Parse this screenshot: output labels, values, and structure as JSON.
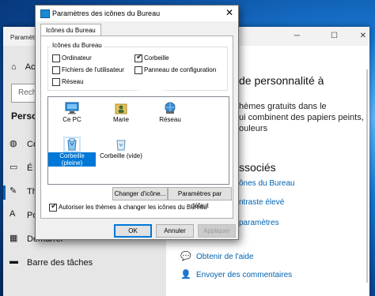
{
  "settings": {
    "window_title": "Paramètres",
    "home_label": "Ac",
    "search_placeholder": "Rech",
    "section_title": "Person",
    "nav": [
      {
        "label": "Co"
      },
      {
        "label": "É"
      },
      {
        "label": "Th"
      },
      {
        "label": "Po"
      },
      {
        "label": "Démarrer"
      },
      {
        "label": "Barre des tâches"
      }
    ],
    "right": {
      "heading1": "de personnalité à",
      "para": [
        "hèmes gratuits dans le",
        "ui combinent des papiers peints,",
        "ouleurs"
      ],
      "heading2": "ssociés",
      "links": [
        "ônes du Bureau",
        "ntraste élevé",
        "paramètres"
      ],
      "help_link": "Obtenir de l'aide",
      "feedback_link": "Envoyer des commentaires"
    }
  },
  "dialog": {
    "title": "Paramètres des icônes du Bureau",
    "tab": "Icônes du Bureau",
    "group_label": "Icônes du Bureau",
    "checkboxes": [
      {
        "label": "Ordinateur",
        "checked": false
      },
      {
        "label": "Corbeille",
        "checked": true
      },
      {
        "label": "Fichiers de l'utilisateur",
        "checked": false
      },
      {
        "label": "Panneau de configuration",
        "checked": false
      },
      {
        "label": "Réseau",
        "checked": false
      }
    ],
    "icons": [
      {
        "label": "Ce PC",
        "icon": "computer-icon"
      },
      {
        "label": "Marie",
        "icon": "user-folder-icon"
      },
      {
        "label": "Réseau",
        "icon": "network-icon"
      },
      {
        "label": "Corbeille (pleine)",
        "icon": "recycle-bin-full-icon",
        "selected": true
      },
      {
        "label": "Corbeille (vide)",
        "icon": "recycle-bin-empty-icon"
      }
    ],
    "change_icon_label": "Changer d'icône...",
    "default_label": "Paramètres par défaut",
    "allow_themes_label": "Autoriser les thèmes à changer les icônes du Bureau",
    "allow_themes_checked": true,
    "ok_label": "OK",
    "cancel_label": "Annuler",
    "apply_label": "Appliquer"
  }
}
